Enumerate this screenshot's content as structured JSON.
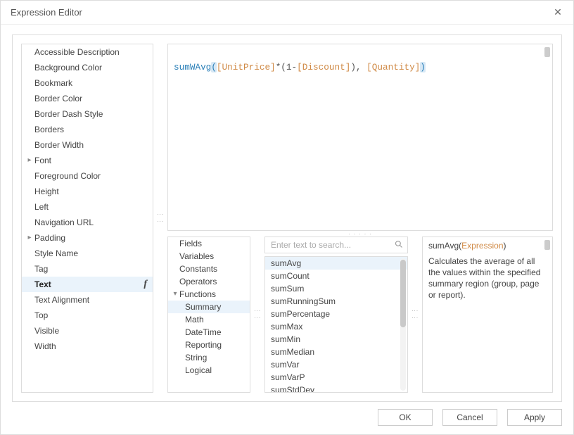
{
  "title": "Expression Editor",
  "properties": [
    {
      "label": "Accessible Description",
      "expandable": false,
      "selected": false
    },
    {
      "label": "Background Color",
      "expandable": false,
      "selected": false
    },
    {
      "label": "Bookmark",
      "expandable": false,
      "selected": false
    },
    {
      "label": "Border Color",
      "expandable": false,
      "selected": false
    },
    {
      "label": "Border Dash Style",
      "expandable": false,
      "selected": false
    },
    {
      "label": "Borders",
      "expandable": false,
      "selected": false
    },
    {
      "label": "Border Width",
      "expandable": false,
      "selected": false
    },
    {
      "label": "Font",
      "expandable": true,
      "selected": false
    },
    {
      "label": "Foreground Color",
      "expandable": false,
      "selected": false
    },
    {
      "label": "Height",
      "expandable": false,
      "selected": false
    },
    {
      "label": "Left",
      "expandable": false,
      "selected": false
    },
    {
      "label": "Navigation URL",
      "expandable": false,
      "selected": false
    },
    {
      "label": "Padding",
      "expandable": true,
      "selected": false
    },
    {
      "label": "Style Name",
      "expandable": false,
      "selected": false
    },
    {
      "label": "Tag",
      "expandable": false,
      "selected": false
    },
    {
      "label": "Text",
      "expandable": false,
      "selected": true,
      "badge": "f"
    },
    {
      "label": "Text Alignment",
      "expandable": false,
      "selected": false
    },
    {
      "label": "Top",
      "expandable": false,
      "selected": false
    },
    {
      "label": "Visible",
      "expandable": false,
      "selected": false
    },
    {
      "label": "Width",
      "expandable": false,
      "selected": false
    }
  ],
  "expression": {
    "fn": "sumWAvg",
    "open": "(",
    "f1": "[UnitPrice]",
    "op1": "*(",
    "num": "1",
    "op2": "-",
    "f2": "[Discount]",
    "op3": "), ",
    "f3": "[Quantity]",
    "close": ")"
  },
  "categories": [
    {
      "label": "Fields",
      "indent": false,
      "expandable": false,
      "selected": false
    },
    {
      "label": "Variables",
      "indent": false,
      "expandable": false,
      "selected": false
    },
    {
      "label": "Constants",
      "indent": false,
      "expandable": false,
      "selected": false
    },
    {
      "label": "Operators",
      "indent": false,
      "expandable": false,
      "selected": false
    },
    {
      "label": "Functions",
      "indent": false,
      "expandable": true,
      "expanded": true,
      "selected": false
    },
    {
      "label": "Summary",
      "indent": true,
      "expandable": false,
      "selected": true
    },
    {
      "label": "Math",
      "indent": true,
      "expandable": false,
      "selected": false
    },
    {
      "label": "DateTime",
      "indent": true,
      "expandable": false,
      "selected": false
    },
    {
      "label": "Reporting",
      "indent": true,
      "expandable": false,
      "selected": false
    },
    {
      "label": "String",
      "indent": true,
      "expandable": false,
      "selected": false
    },
    {
      "label": "Logical",
      "indent": true,
      "expandable": false,
      "selected": false
    }
  ],
  "search": {
    "placeholder": "Enter text to search..."
  },
  "functions": [
    {
      "label": "sumAvg",
      "selected": true
    },
    {
      "label": "sumCount",
      "selected": false
    },
    {
      "label": "sumSum",
      "selected": false
    },
    {
      "label": "sumRunningSum",
      "selected": false
    },
    {
      "label": "sumPercentage",
      "selected": false
    },
    {
      "label": "sumMax",
      "selected": false
    },
    {
      "label": "sumMin",
      "selected": false
    },
    {
      "label": "sumMedian",
      "selected": false
    },
    {
      "label": "sumVar",
      "selected": false
    },
    {
      "label": "sumVarP",
      "selected": false
    },
    {
      "label": "sumStdDev",
      "selected": false
    }
  ],
  "description": {
    "sig_fn": "sumAvg",
    "sig_open": "(",
    "sig_arg": "Expression",
    "sig_close": ")",
    "text": "Calculates the average of all the values within the specified summary region (group, page or report)."
  },
  "buttons": {
    "ok": "OK",
    "cancel": "Cancel",
    "apply": "Apply"
  }
}
